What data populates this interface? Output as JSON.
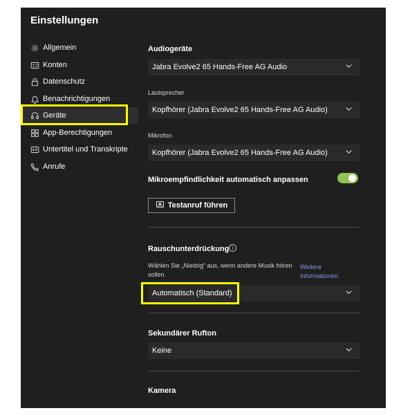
{
  "window": {
    "title": "Einstellungen"
  },
  "sidebar": {
    "items": [
      {
        "label": "Allgemein",
        "icon": "gear-icon"
      },
      {
        "label": "Konten",
        "icon": "id-card-icon"
      },
      {
        "label": "Datenschutz",
        "icon": "lock-icon"
      },
      {
        "label": "Benachrichtigungen",
        "icon": "bell-icon"
      },
      {
        "label": "Geräte",
        "icon": "headset-icon",
        "active": true
      },
      {
        "label": "App-Berechtigungen",
        "icon": "grid-icon"
      },
      {
        "label": "Untertitel und Transkripte",
        "icon": "cc-icon"
      },
      {
        "label": "Anrufe",
        "icon": "phone-icon"
      }
    ]
  },
  "main": {
    "audio": {
      "heading": "Audiogeräte",
      "selected": "Jabra Evolve2 65 Hands-Free AG Audio"
    },
    "speaker": {
      "label": "Lautsprecher",
      "selected": "Kopfhörer (Jabra Evolve2 65 Hands-Free AG Audio)"
    },
    "mic": {
      "label": "Mikrofon",
      "selected": "Kopfhörer (Jabra Evolve2 65 Hands-Free AG Audio)"
    },
    "auto_adjust": {
      "label": "Mikroempfindlichkeit automatisch anpassen",
      "enabled": true
    },
    "test_call": {
      "label": "Testanruf führen"
    },
    "noise": {
      "heading": "Rauschunterdrückung",
      "info_glyph": "i",
      "description": "Wählen Sie „Niedrig“ aus, wenn andere Musik hören sollen.",
      "link": "Weitere Informationen.",
      "selected": "Automatisch (Standard)"
    },
    "ringtone": {
      "heading": "Sekundärer Rufton",
      "selected": "Keine"
    },
    "camera": {
      "heading": "Kamera"
    }
  },
  "colors": {
    "window_bg": "#1f1f1f",
    "accent_highlight": "#ffff00",
    "toggle_on": "#92c353",
    "link": "#8a93e8"
  }
}
